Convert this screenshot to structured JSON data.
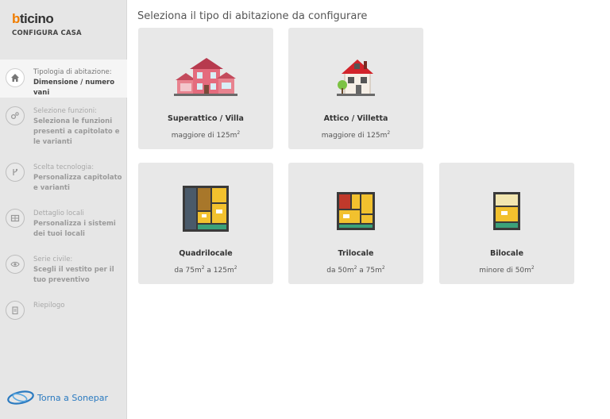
{
  "brand": {
    "logo_main": "bticino",
    "subtitle": "CONFIGURA CASA"
  },
  "sidebar": {
    "steps": [
      {
        "title": "Tipologia di abitazione:",
        "desc": "Dimensione / numero vani",
        "icon": "home-icon",
        "active": true
      },
      {
        "title": "Selezione funzioni:",
        "desc": "Seleziona le funzioni presenti a capitolato e le varianti",
        "icon": "settings-icon",
        "active": false
      },
      {
        "title": "Scelta tecnologia:",
        "desc": "Personalizza capitolato e varianti",
        "icon": "technology-icon",
        "active": false
      },
      {
        "title": "Dettaglio locali",
        "desc": "Personalizza i sistemi dei tuoi locali",
        "icon": "floorplan-icon",
        "active": false
      },
      {
        "title": "Serie civile:",
        "desc": "Scegli il vestito per il tuo preventivo",
        "icon": "eye-icon",
        "active": false
      },
      {
        "title": "Riepilogo",
        "desc": "",
        "icon": "clipboard-icon",
        "active": false
      }
    ],
    "back_link": "Torna a Sonepar"
  },
  "main": {
    "title": "Seleziona il tipo di abitazione da configurare",
    "cards": [
      {
        "name": "Superattico / Villa",
        "size_prefix": "maggiore di 125m",
        "size_exp": "2",
        "size_suffix": ""
      },
      {
        "name": "Attico / Villetta",
        "size_prefix": "maggiore di 125m",
        "size_exp": "2",
        "size_suffix": ""
      },
      {
        "name": "Quadrilocale",
        "size_prefix": "da 75m",
        "size_exp": "2",
        "size_suffix": " a 125m",
        "size_exp2": "2"
      },
      {
        "name": "Trilocale",
        "size_prefix": "da 50m",
        "size_exp": "2",
        "size_suffix": " a 75m",
        "size_exp2": "2"
      },
      {
        "name": "Bilocale",
        "size_prefix": "minore di 50m",
        "size_exp": "2",
        "size_suffix": ""
      }
    ]
  },
  "colors": {
    "accent": "#f07d00",
    "link": "#2a7ac0",
    "card_bg": "#e8e8e8",
    "sidebar_bg": "#e6e6e6"
  }
}
